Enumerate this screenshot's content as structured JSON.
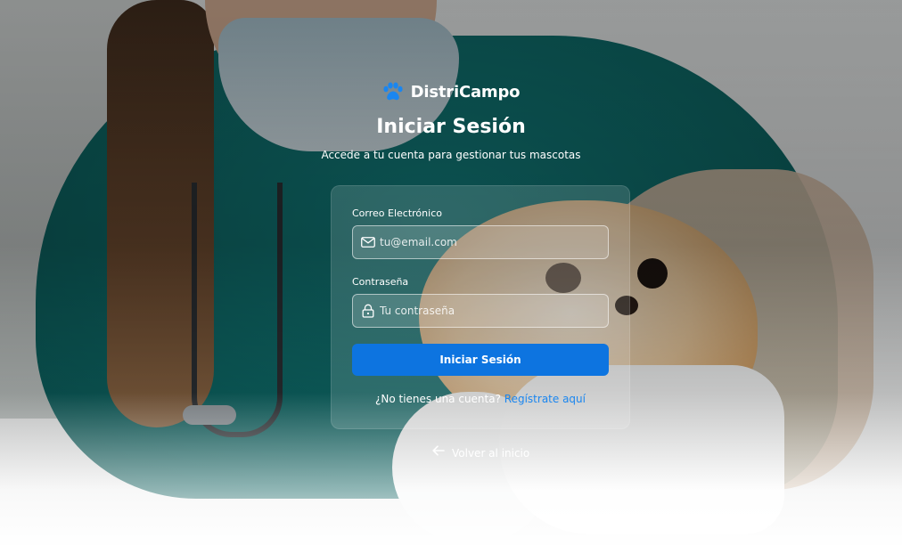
{
  "brand": {
    "name": "DistriCampo",
    "logo_icon": "paw-icon",
    "accent_color": "#1a86f0"
  },
  "login": {
    "title": "Iniciar Sesión",
    "subtitle": "Accede a tu cuenta para gestionar tus mascotas",
    "email": {
      "label": "Correo Electrónico",
      "placeholder": "tu@email.com",
      "value": "",
      "icon": "mail-icon"
    },
    "password": {
      "label": "Contraseña",
      "placeholder": "Tu contraseña",
      "value": "",
      "icon": "lock-icon"
    },
    "submit_label": "Iniciar Sesión",
    "submit_color": "#0d74e0",
    "register_prompt": "¿No tienes una cuenta?",
    "register_link": "Regístrate aquí"
  },
  "back_link": {
    "label": "Volver al inicio",
    "icon": "arrow-left-icon"
  }
}
